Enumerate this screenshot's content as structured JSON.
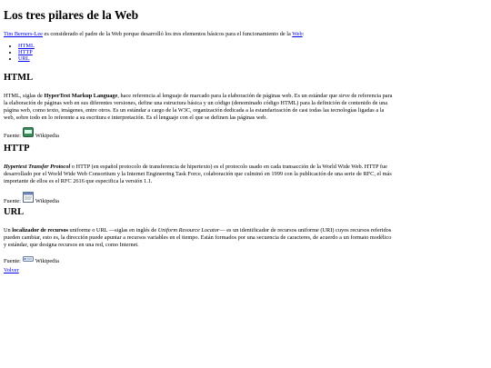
{
  "page": {
    "title": "Los tres pilares de la Web",
    "intro": {
      "author_link": "Tim Berners-Lee",
      "text": " es considerado el padre de la Web porque desarrolló los tres elementos básicos para el funcionamiento de la ",
      "web_link": "Web",
      "end": ":"
    },
    "nav_links": [
      "HTML",
      "HTTP",
      "URL"
    ],
    "sections": [
      {
        "heading": "HTML",
        "pre": "HTML, siglas de ",
        "term": "HyperText Markup Language",
        "body": ", hace referencia al lenguaje de marcado para la elaboración de páginas web. Es un estándar que sirve de referencia para la elaboración de páginas web en sus diferentes versiones, define una estructura básica y un código (denominado código HTML) para la definición de contenido de una página web, como texto, imágenes, entre otros. Es un estándar a cargo de la W3C, organización dedicada a la estandarización de casi todas las tecnologías ligadas a la web, sobre todo en lo referente a su escritura e interpretación. Es el lenguaje con el que se definen las páginas web.",
        "source_label": "Fuente:",
        "source_icon": "html-logo-icon",
        "source_name": "Wikipedia"
      },
      {
        "heading": "HTTP",
        "term": "Hypertext Transfer Protocol",
        "body": " o HTTP (en español protocolo de transferencia de hipertexto) es el protocolo usado en cada transacción de la World Wide Web. HTTP fue desarrollado por el World Wide Web Consortium y la Internet Engineering Task Force, colaboración que culminó en 1999 con la publicación de una serie de RFC, el más importante de ellos es el RFC 2616 que especifica la versión 1.1.",
        "source_label": "Fuente:",
        "source_icon": "http-document-icon",
        "source_name": "Wikipedia"
      },
      {
        "heading": "URL",
        "pre": "Un ",
        "term": "localizador de recursos",
        "mid": " uniforme o URL —siglas en inglés de ",
        "term_en": "Uniform Resource Locator",
        "body": "— es un identificador de recursos uniforme (URI) cuyos recursos referidos pueden cambiar, esto es, la dirección puede apuntar a recursos variables en el tiempo. Están formados por una secuencia de caracteres, de acuerdo a un formato modélico y estándar, que designa recursos en una red, como Internet.",
        "source_label": "Fuente:",
        "source_icon": "url-bar-icon",
        "source_name": "Wikipedia"
      }
    ],
    "back_link": "Volver"
  }
}
